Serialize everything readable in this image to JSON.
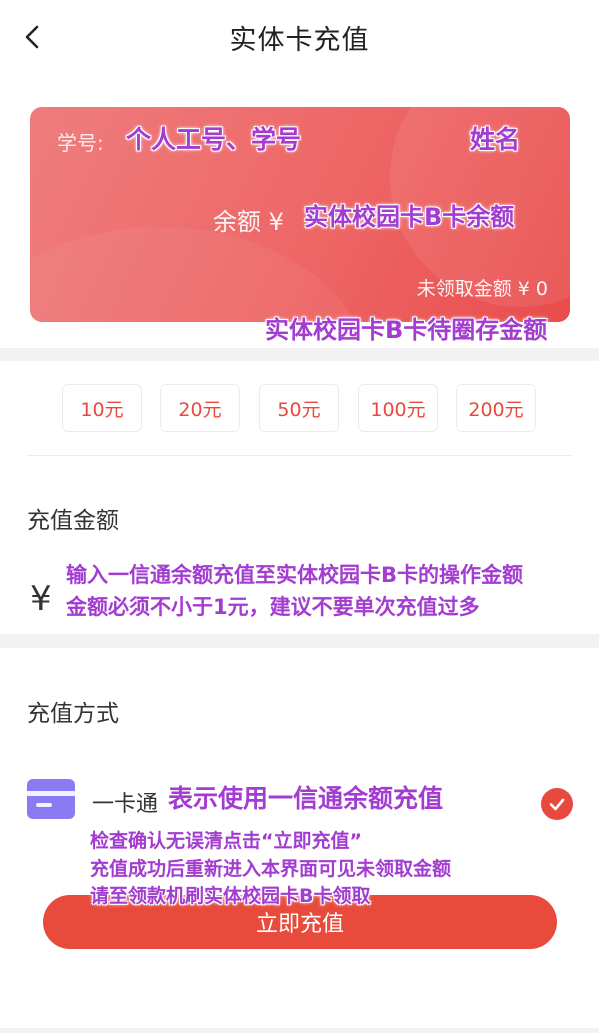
{
  "header": {
    "title": "实体卡充值",
    "back_icon": "chevron-left-icon"
  },
  "card": {
    "id_label": "学号:",
    "balance_label": "余额 ¥",
    "unclaimed_text": "未领取金额 ¥ 0",
    "gradient_colors": [
      "#ef7d7d",
      "#e94c4c"
    ]
  },
  "annotations": {
    "id_note": "个人工号、学号",
    "name_note": "姓名",
    "balance_note": "实体校园卡B卡余额",
    "unclaimed_note": "实体校园卡B卡待圈存金额",
    "amount_note_1": "输入一信通余额充值至实体校园卡B卡的操作金额",
    "amount_note_2": "金额必须不小于1元，建议不要单次充值过多",
    "method_note": "表示使用一信通余额充值",
    "submit_note_1": "检查确认无误清点击“立即充值”",
    "submit_note_2": "充值成功后重新进入本界面可见未领取金额",
    "submit_note_3": "请至领款机刷实体校园卡B卡领取"
  },
  "presets": [
    "10元",
    "20元",
    "50元",
    "100元",
    "200元"
  ],
  "amount": {
    "label": "充值金额",
    "currency": "¥",
    "value": "",
    "placeholder": ""
  },
  "pay": {
    "label": "充值方式",
    "method": "一卡通",
    "method_icon": "card-icon",
    "check_icon": "check-circle-icon",
    "submit_label": "立即充值"
  },
  "colors": {
    "accent": "#e8493e",
    "annotation": "#a33cd1",
    "method_icon": "#8b7bf2"
  }
}
